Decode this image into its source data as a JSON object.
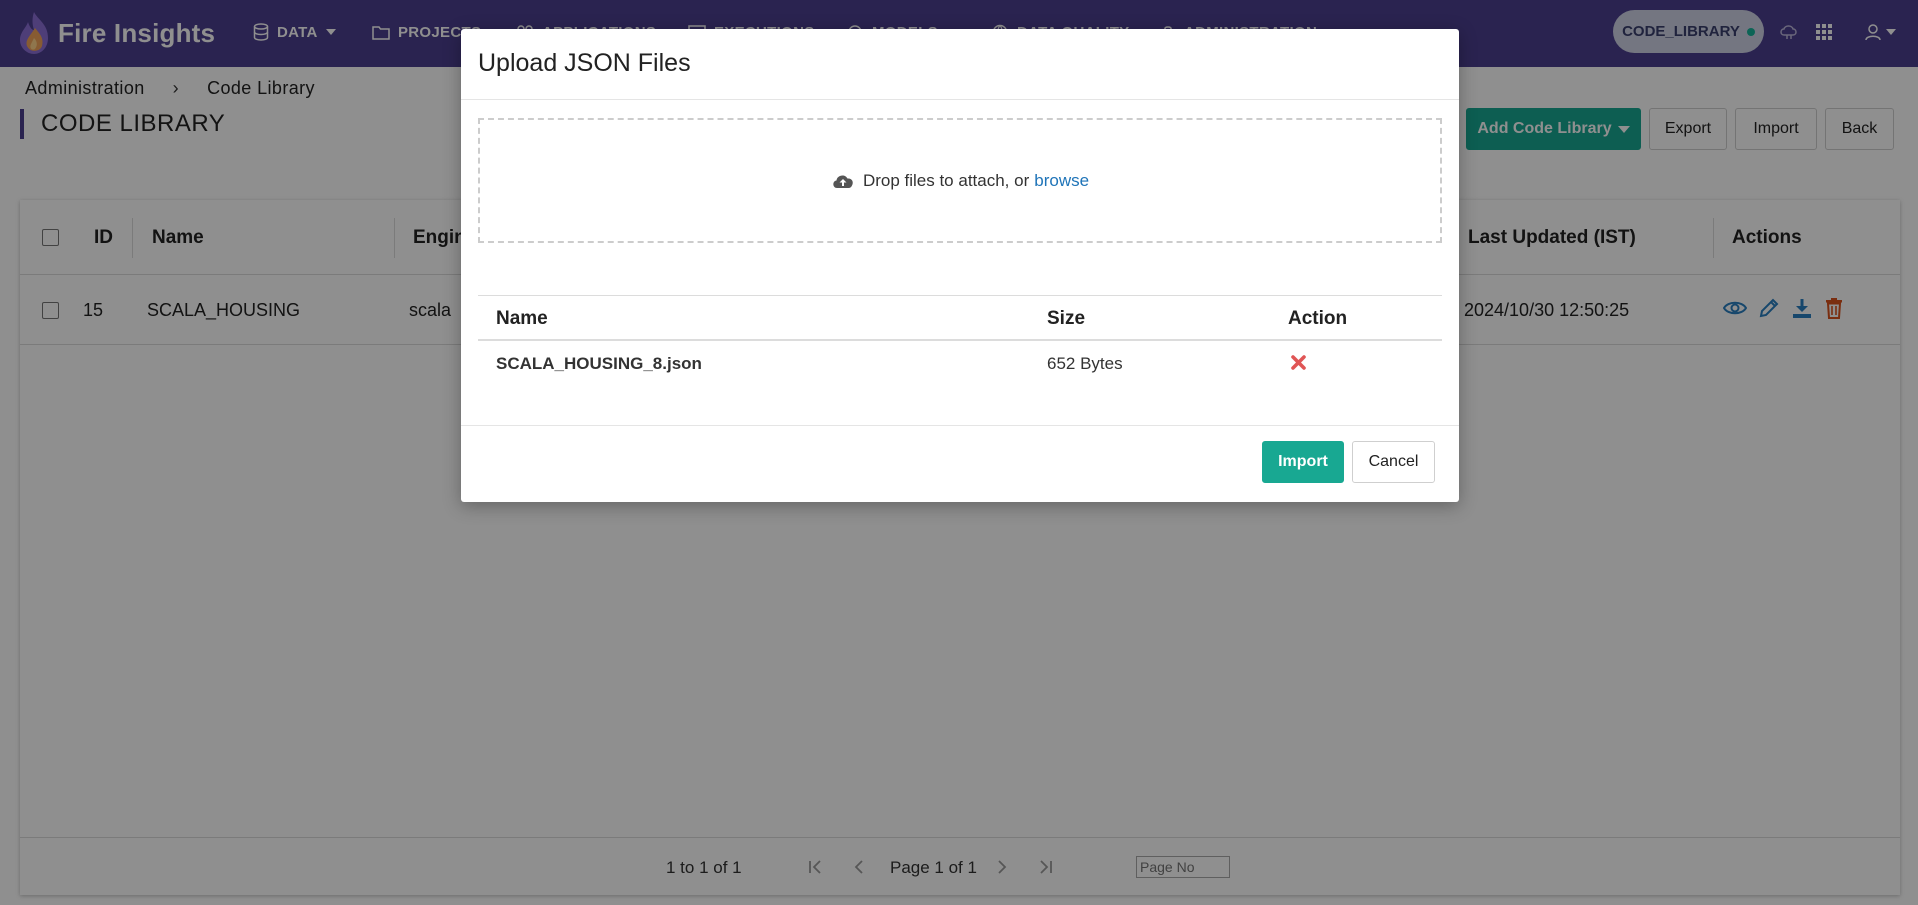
{
  "app": {
    "name": "Fire Insights",
    "nav": [
      {
        "label": "DATA",
        "icon": "database-icon",
        "dropdown": true
      },
      {
        "label": "PROJECTS",
        "icon": "folder-icon",
        "dropdown": false
      },
      {
        "label": "APPLICATIONS",
        "icon": "applications-icon",
        "dropdown": false
      },
      {
        "label": "EXECUTIONS",
        "icon": "executions-icon",
        "dropdown": false
      },
      {
        "label": "MODELS",
        "icon": "models-icon",
        "dropdown": true
      },
      {
        "label": "DATA QUALITY",
        "icon": "globe-icon",
        "dropdown": false
      },
      {
        "label": "ADMINISTRATION",
        "icon": "lock-icon",
        "dropdown": false
      }
    ],
    "workspace_label": "CODE_LIBRARY",
    "workspace_status_color": "#17b29a",
    "right_icons": [
      "cloud-icon",
      "apps-grid-icon",
      "user-icon"
    ]
  },
  "breadcrumb": {
    "items": [
      "Administration",
      "Code Library"
    ],
    "separator": "›"
  },
  "page": {
    "title": "CODE LIBRARY",
    "actions": {
      "add": "Add Code Library",
      "export": "Export",
      "import": "Import",
      "back": "Back"
    }
  },
  "grid": {
    "columns": {
      "id": "ID",
      "name": "Name",
      "engine": "Engin",
      "last_updated": "Last Updated (IST)",
      "actions": "Actions"
    },
    "rows": [
      {
        "id": "15",
        "name": "SCALA_HOUSING",
        "engine": "scala",
        "last_updated": "2024/10/30 12:50:25"
      }
    ],
    "row_action_icons": [
      "eye-icon",
      "pencil-icon",
      "download-icon",
      "trash-icon"
    ],
    "pagination": {
      "range": "1 to 1 of 1",
      "page": "Page 1 of 1",
      "page_input_placeholder": "Page No"
    }
  },
  "modal": {
    "title": "Upload JSON Files",
    "dropzone": {
      "text": "Drop files to attach, or",
      "link": "browse",
      "icon": "cloud-upload-icon"
    },
    "columns": {
      "name": "Name",
      "size": "Size",
      "action": "Action"
    },
    "files": [
      {
        "name": "SCALA_HOUSING_8.json",
        "size": "652 Bytes",
        "action_icon": "remove-icon"
      }
    ],
    "buttons": {
      "import": "Import",
      "cancel": "Cancel"
    }
  },
  "colors": {
    "nav_bg": "#4c3f8f",
    "primary": "#18a892",
    "link": "#1f74b8",
    "danger": "#e05555",
    "action_blue": "#2a7fc0",
    "action_trash": "#d9531e"
  }
}
